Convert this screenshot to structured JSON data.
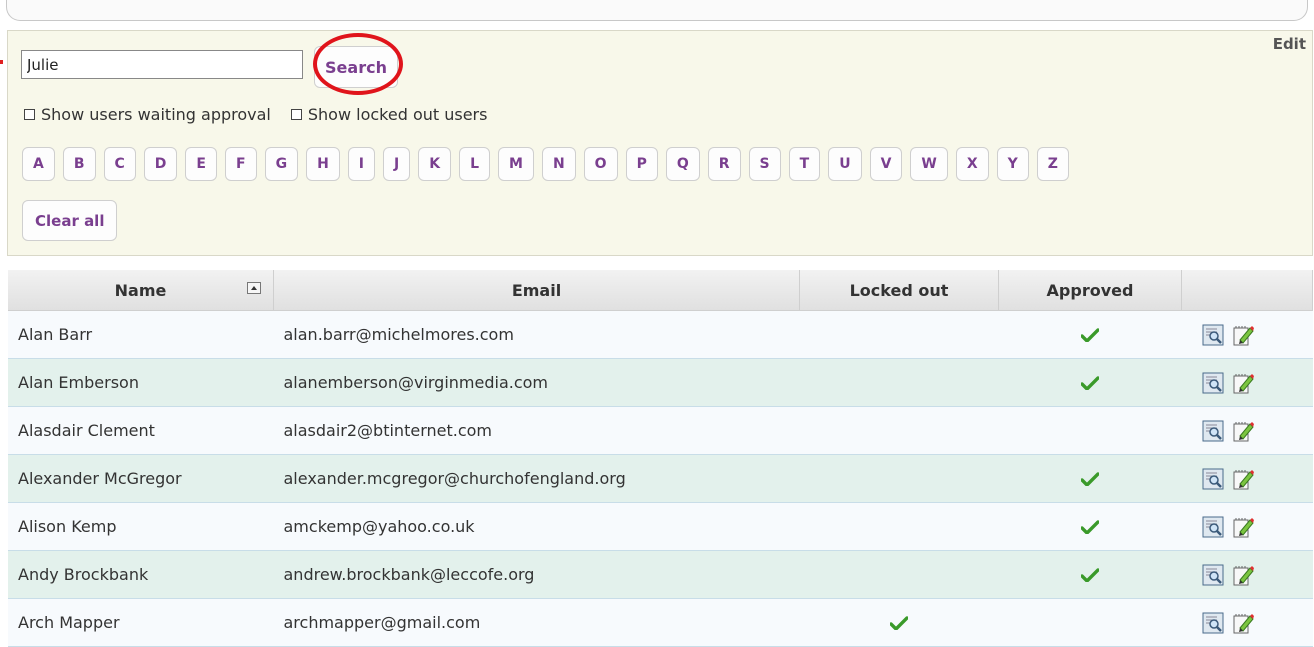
{
  "search": {
    "value": "Julie",
    "button_label": "Search",
    "edit_label": "Edit",
    "waiting_label": "Show users waiting approval",
    "locked_label": "Show locked out users"
  },
  "letters": [
    "A",
    "B",
    "C",
    "D",
    "E",
    "F",
    "G",
    "H",
    "I",
    "J",
    "K",
    "L",
    "M",
    "N",
    "O",
    "P",
    "Q",
    "R",
    "S",
    "T",
    "U",
    "V",
    "W",
    "X",
    "Y",
    "Z"
  ],
  "clear_label": "Clear all",
  "table": {
    "headers": [
      "Name",
      "Email",
      "Locked out",
      "Approved",
      ""
    ],
    "rows": [
      {
        "name": "Alan Barr",
        "email": "alan.barr@michelmores.com",
        "locked": false,
        "approved": true
      },
      {
        "name": "Alan Emberson",
        "email": "alanemberson@virginmedia.com",
        "locked": false,
        "approved": true
      },
      {
        "name": "Alasdair Clement",
        "email": "alasdair2@btinternet.com",
        "locked": false,
        "approved": false
      },
      {
        "name": "Alexander McGregor",
        "email": "alexander.mcgregor@churchofengland.org",
        "locked": false,
        "approved": true
      },
      {
        "name": "Alison Kemp",
        "email": "amckemp@yahoo.co.uk",
        "locked": false,
        "approved": true
      },
      {
        "name": "Andy Brockbank",
        "email": "andrew.brockbank@leccofe.org",
        "locked": false,
        "approved": true
      },
      {
        "name": "Arch Mapper",
        "email": "archmapper@gmail.com",
        "locked": true,
        "approved": false
      }
    ]
  },
  "colors": {
    "accent": "#7a3f8f",
    "check": "#3a9a2a",
    "annotation": "#e0141b"
  }
}
